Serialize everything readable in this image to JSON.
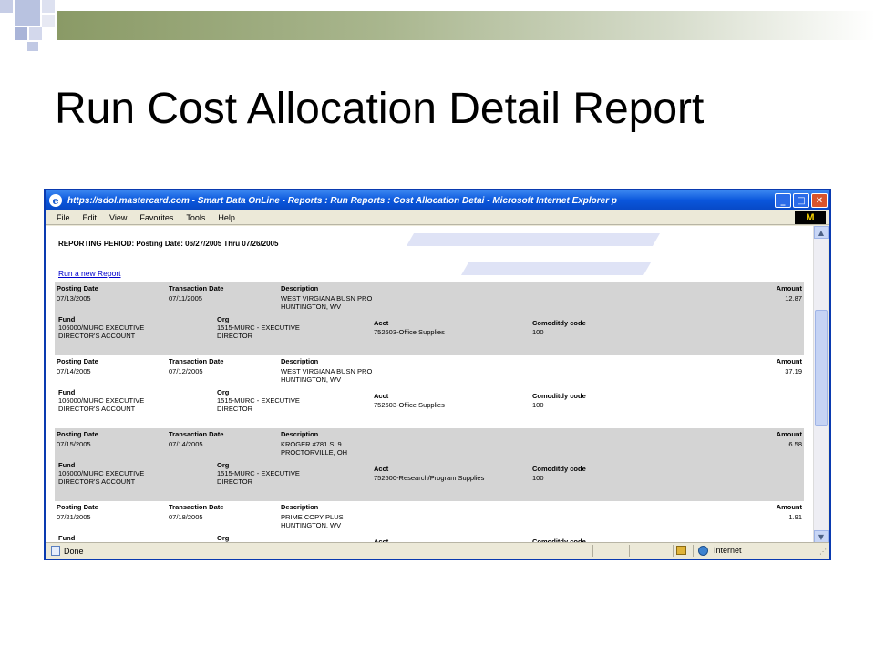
{
  "slide": {
    "title": "Run Cost Allocation Detail Report"
  },
  "window": {
    "title": "https://sdol.mastercard.com - Smart Data OnLine - Reports : Run Reports : Cost Allocation Detai - Microsoft Internet Explorer p",
    "ie_glyph": "e",
    "min": "_",
    "max": "□",
    "close": "✕",
    "logo": "M"
  },
  "menu": [
    "File",
    "Edit",
    "View",
    "Favorites",
    "Tools",
    "Help"
  ],
  "report": {
    "period": "REPORTING PERIOD: Posting Date: 06/27/2005 Thru 07/26/2005",
    "run_link": "Run a new Report",
    "headers": {
      "posting": "Posting Date",
      "transaction": "Transaction Date",
      "description": "Description",
      "amount": "Amount",
      "fund": "Fund",
      "org": "Org",
      "acct": "Acct",
      "commodity": "Comoditdy code"
    },
    "transactions": [
      {
        "posting": "07/13/2005",
        "transaction": "07/11/2005",
        "desc1": "WEST VIRGIANA BUSN PRO",
        "desc2": "HUNTINGTON, WV",
        "amount": "12.87",
        "fund1": "106000/MURC EXECUTIVE",
        "fund2": "DIRECTOR'S ACCOUNT",
        "org1": "1515-MURC - EXECUTIVE",
        "org2": "DIRECTOR",
        "acct": "752603-Office Supplies",
        "commodity": "100"
      },
      {
        "posting": "07/14/2005",
        "transaction": "07/12/2005",
        "desc1": "WEST VIRGIANA BUSN PRO",
        "desc2": "HUNTINGTON, WV",
        "amount": "37.19",
        "fund1": "106000/MURC EXECUTIVE",
        "fund2": "DIRECTOR'S ACCOUNT",
        "org1": "1515-MURC - EXECUTIVE",
        "org2": "DIRECTOR",
        "acct": "752603-Office Supplies",
        "commodity": "100"
      },
      {
        "posting": "07/15/2005",
        "transaction": "07/14/2005",
        "desc1": "KROGER #781 SL9",
        "desc2": "PROCTORVILLE, OH",
        "amount": "6.58",
        "fund1": "106000/MURC EXECUTIVE",
        "fund2": "DIRECTOR'S ACCOUNT",
        "org1": "1515-MURC - EXECUTIVE",
        "org2": "DIRECTOR",
        "acct": "752600-Research/Program Supplies",
        "commodity": "100"
      },
      {
        "posting": "07/21/2005",
        "transaction": "07/18/2005",
        "desc1": "PRIME COPY PLUS",
        "desc2": "HUNTINGTON, WV",
        "amount": "1.91"
      }
    ]
  },
  "scrollbar": {
    "up": "▲",
    "down": "▼"
  },
  "status": {
    "text": "Done",
    "zone": "Internet",
    "grip": "⋰"
  }
}
